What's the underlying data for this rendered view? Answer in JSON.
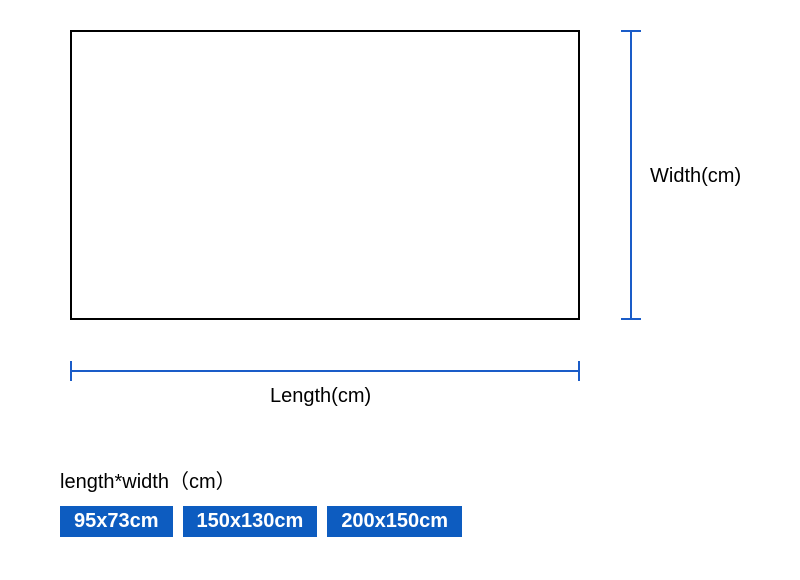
{
  "diagram": {
    "width_label": "Width(cm)",
    "length_label": "Length(cm)"
  },
  "sizes": {
    "title": "length*width（cm）",
    "options": [
      "95x73cm",
      "150x130cm",
      "200x150cm"
    ]
  },
  "colors": {
    "dimension_line": "#1a5cc8",
    "badge_bg": "#0d5cc0",
    "badge_text": "#ffffff"
  }
}
